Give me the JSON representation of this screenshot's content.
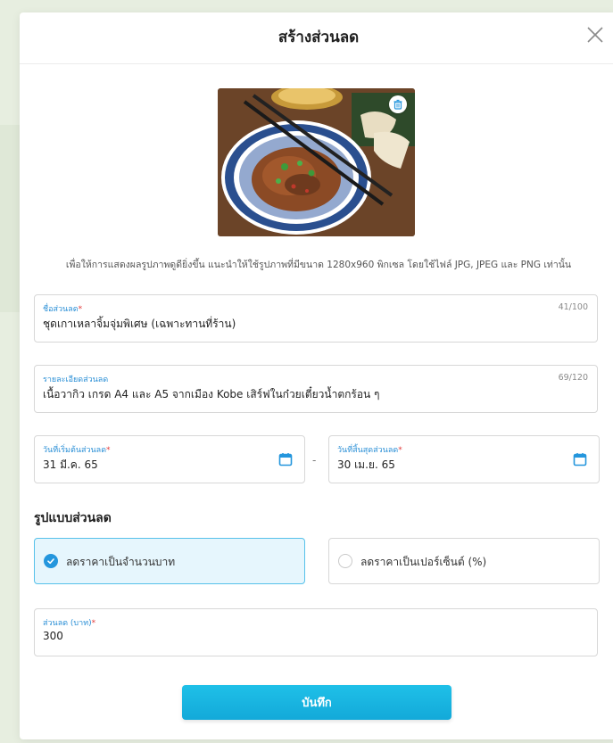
{
  "modal": {
    "title": "สร้างส่วนลด"
  },
  "image": {
    "hint": "เพื่อให้การแสดงผลรูปภาพดูดียิ่งขึ้น แนะนำให้ใช้รูปภาพที่มีขนาด 1280x960 พิกเซล โดยใช้ไฟล์ JPG, JPEG และ PNG เท่านั้น"
  },
  "fields": {
    "name": {
      "label": "ชื่อส่วนลด",
      "required_mark": "*",
      "value": "ชุดเกาเหลาจิ้มจุ่มพิเศษ (เฉพาะทานที่ร้าน)",
      "count": "41/100"
    },
    "description": {
      "label": "รายละเอียดส่วนลด",
      "value": "เนื้อวากิว เกรด A4 และ A5 จากเมือง Kobe เสิร์ฟในก๋วยเตี๋ยวน้ำตกร้อน ๆ",
      "count": "69/120"
    },
    "start_date": {
      "label": "วันที่เริ่มต้นส่วนลด",
      "required_mark": "*",
      "value": "31 มี.ค. 65"
    },
    "separator": "-",
    "end_date": {
      "label": "วันที่สิ้นสุดส่วนลด",
      "required_mark": "*",
      "value": "30 เม.ย. 65"
    },
    "amount": {
      "label": "ส่วนลด (บาท)",
      "required_mark": "*",
      "value": "300"
    }
  },
  "discount_type": {
    "title": "รูปแบบส่วนลด",
    "options": [
      {
        "label": "ลดราคาเป็นจำนวนบาท",
        "selected": true
      },
      {
        "label": "ลดราคาเป็นเปอร์เซ็นต์ (%)",
        "selected": false
      }
    ]
  },
  "actions": {
    "save_label": "บันทึก"
  },
  "colors": {
    "accent": "#2496dd",
    "label_blue": "#2a8fd6",
    "required": "#e23b3b",
    "button": "#13a9d9",
    "selected_bg": "#e6f6fd"
  },
  "icons": [
    "close-icon",
    "trash-icon",
    "calendar-icon",
    "check-icon"
  ]
}
